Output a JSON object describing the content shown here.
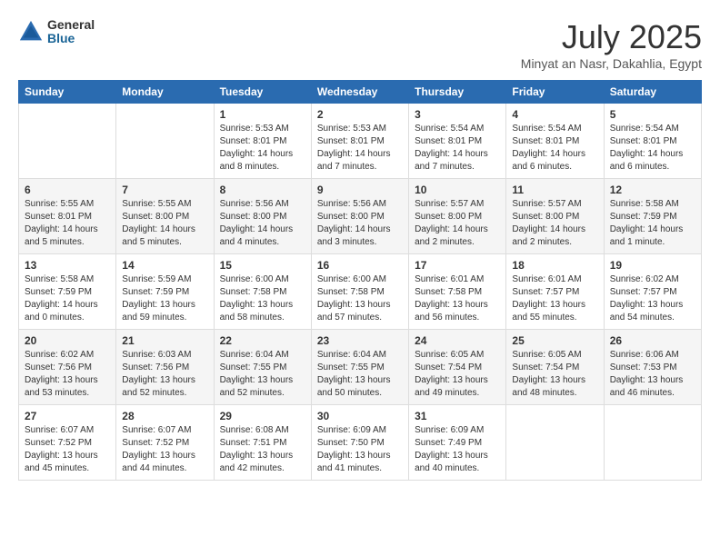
{
  "header": {
    "logo_general": "General",
    "logo_blue": "Blue",
    "month_title": "July 2025",
    "location": "Minyat an Nasr, Dakahlia, Egypt"
  },
  "days_of_week": [
    "Sunday",
    "Monday",
    "Tuesday",
    "Wednesday",
    "Thursday",
    "Friday",
    "Saturday"
  ],
  "weeks": [
    [
      {
        "day": "",
        "info": ""
      },
      {
        "day": "",
        "info": ""
      },
      {
        "day": "1",
        "info": "Sunrise: 5:53 AM\nSunset: 8:01 PM\nDaylight: 14 hours and 8 minutes."
      },
      {
        "day": "2",
        "info": "Sunrise: 5:53 AM\nSunset: 8:01 PM\nDaylight: 14 hours and 7 minutes."
      },
      {
        "day": "3",
        "info": "Sunrise: 5:54 AM\nSunset: 8:01 PM\nDaylight: 14 hours and 7 minutes."
      },
      {
        "day": "4",
        "info": "Sunrise: 5:54 AM\nSunset: 8:01 PM\nDaylight: 14 hours and 6 minutes."
      },
      {
        "day": "5",
        "info": "Sunrise: 5:54 AM\nSunset: 8:01 PM\nDaylight: 14 hours and 6 minutes."
      }
    ],
    [
      {
        "day": "6",
        "info": "Sunrise: 5:55 AM\nSunset: 8:01 PM\nDaylight: 14 hours and 5 minutes."
      },
      {
        "day": "7",
        "info": "Sunrise: 5:55 AM\nSunset: 8:00 PM\nDaylight: 14 hours and 5 minutes."
      },
      {
        "day": "8",
        "info": "Sunrise: 5:56 AM\nSunset: 8:00 PM\nDaylight: 14 hours and 4 minutes."
      },
      {
        "day": "9",
        "info": "Sunrise: 5:56 AM\nSunset: 8:00 PM\nDaylight: 14 hours and 3 minutes."
      },
      {
        "day": "10",
        "info": "Sunrise: 5:57 AM\nSunset: 8:00 PM\nDaylight: 14 hours and 2 minutes."
      },
      {
        "day": "11",
        "info": "Sunrise: 5:57 AM\nSunset: 8:00 PM\nDaylight: 14 hours and 2 minutes."
      },
      {
        "day": "12",
        "info": "Sunrise: 5:58 AM\nSunset: 7:59 PM\nDaylight: 14 hours and 1 minute."
      }
    ],
    [
      {
        "day": "13",
        "info": "Sunrise: 5:58 AM\nSunset: 7:59 PM\nDaylight: 14 hours and 0 minutes."
      },
      {
        "day": "14",
        "info": "Sunrise: 5:59 AM\nSunset: 7:59 PM\nDaylight: 13 hours and 59 minutes."
      },
      {
        "day": "15",
        "info": "Sunrise: 6:00 AM\nSunset: 7:58 PM\nDaylight: 13 hours and 58 minutes."
      },
      {
        "day": "16",
        "info": "Sunrise: 6:00 AM\nSunset: 7:58 PM\nDaylight: 13 hours and 57 minutes."
      },
      {
        "day": "17",
        "info": "Sunrise: 6:01 AM\nSunset: 7:58 PM\nDaylight: 13 hours and 56 minutes."
      },
      {
        "day": "18",
        "info": "Sunrise: 6:01 AM\nSunset: 7:57 PM\nDaylight: 13 hours and 55 minutes."
      },
      {
        "day": "19",
        "info": "Sunrise: 6:02 AM\nSunset: 7:57 PM\nDaylight: 13 hours and 54 minutes."
      }
    ],
    [
      {
        "day": "20",
        "info": "Sunrise: 6:02 AM\nSunset: 7:56 PM\nDaylight: 13 hours and 53 minutes."
      },
      {
        "day": "21",
        "info": "Sunrise: 6:03 AM\nSunset: 7:56 PM\nDaylight: 13 hours and 52 minutes."
      },
      {
        "day": "22",
        "info": "Sunrise: 6:04 AM\nSunset: 7:55 PM\nDaylight: 13 hours and 52 minutes."
      },
      {
        "day": "23",
        "info": "Sunrise: 6:04 AM\nSunset: 7:55 PM\nDaylight: 13 hours and 50 minutes."
      },
      {
        "day": "24",
        "info": "Sunrise: 6:05 AM\nSunset: 7:54 PM\nDaylight: 13 hours and 49 minutes."
      },
      {
        "day": "25",
        "info": "Sunrise: 6:05 AM\nSunset: 7:54 PM\nDaylight: 13 hours and 48 minutes."
      },
      {
        "day": "26",
        "info": "Sunrise: 6:06 AM\nSunset: 7:53 PM\nDaylight: 13 hours and 46 minutes."
      }
    ],
    [
      {
        "day": "27",
        "info": "Sunrise: 6:07 AM\nSunset: 7:52 PM\nDaylight: 13 hours and 45 minutes."
      },
      {
        "day": "28",
        "info": "Sunrise: 6:07 AM\nSunset: 7:52 PM\nDaylight: 13 hours and 44 minutes."
      },
      {
        "day": "29",
        "info": "Sunrise: 6:08 AM\nSunset: 7:51 PM\nDaylight: 13 hours and 42 minutes."
      },
      {
        "day": "30",
        "info": "Sunrise: 6:09 AM\nSunset: 7:50 PM\nDaylight: 13 hours and 41 minutes."
      },
      {
        "day": "31",
        "info": "Sunrise: 6:09 AM\nSunset: 7:49 PM\nDaylight: 13 hours and 40 minutes."
      },
      {
        "day": "",
        "info": ""
      },
      {
        "day": "",
        "info": ""
      }
    ]
  ]
}
